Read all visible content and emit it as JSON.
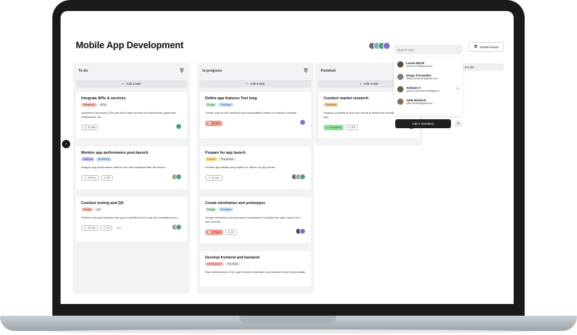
{
  "board": {
    "title": "Mobile App Development",
    "delete_label": "Delete board",
    "search_placeholder": "Search user",
    "add_list_label": "d a list",
    "members": [
      "#6b6b6b",
      "#8aa9c9",
      "#4f9a7a",
      "#7b6fd1"
    ]
  },
  "columns": [
    {
      "title": "To do",
      "add_task_label": "Add a task",
      "cards": [
        {
          "title": "Integrate APIs & services",
          "tags": [
            {
              "label": "Integration",
              "bg": "#f6c4bd",
              "fg": "#7a2b22"
            },
            {
              "label": "APIs",
              "bg": "#ececec",
              "fg": "#444"
            }
          ],
          "desc": "Implement necessary APIs and third-party services for features like payments, notifications, etc.",
          "date": "10 Jan.",
          "avatars": [
            "#4f9a7a"
          ]
        },
        {
          "title": "Monitor app performance post-launch",
          "tags": [
            {
              "label": "Analysis",
              "bg": "#cfc2f6",
              "fg": "#3e2d7a"
            },
            {
              "label": "Monitoring",
              "bg": "#cde0f8",
              "fg": "#23507e"
            }
          ],
          "desc": "Analyze app performance metrics and user feedback after the launch.",
          "date": "15 Feb.",
          "progress": "0/3",
          "avatars": [
            "#a89c8a",
            "#4f9a7a"
          ]
        },
        {
          "title": "Conduct testing and QA",
          "tags": [
            {
              "label": "Testing",
              "bg": "#f6c4bd",
              "fg": "#7a2b22"
            },
            {
              "label": "QA",
              "bg": "#ececec",
              "fg": "#444"
            }
          ],
          "desc": "Perform thorough testing of the app to identify and fix bugs and usability issues.",
          "date": "20 Jan.",
          "progress": "1/3",
          "comments": "1",
          "avatars": [
            "#a89c8a",
            "#4f9a7a"
          ]
        }
      ]
    },
    {
      "title": "In progress",
      "add_task_label": "Add a task",
      "cards": [
        {
          "title": "Define app features Test long",
          "tags": [
            {
              "label": "Design",
              "bg": "#cdefd2",
              "fg": "#24622e"
            },
            {
              "label": "Prototype",
              "bg": "#cde0f8",
              "fg": "#23507e"
            }
          ],
          "desc": "Create a list of core features and functionalities based on research findings.",
          "date": "15 Oct.",
          "date_red": true,
          "avatars": [
            "#7b6fd1"
          ]
        },
        {
          "title": "Prepare for app launch",
          "tags": [
            {
              "label": "Launch",
              "bg": "#f8e38a",
              "fg": "#6a5410"
            },
            {
              "label": "Preparation",
              "bg": "#ececec",
              "fg": "#444"
            }
          ],
          "desc": "Finalize app details and prepare for launch on app stores.",
          "date": "31 Jan.",
          "avatars": [
            "#6b6b6b",
            "#a89c8a",
            "#4f9a7a"
          ]
        },
        {
          "title": "Create wireframes and prototypes",
          "tags": [
            {
              "label": "Design",
              "bg": "#cdefd2",
              "fg": "#24622e"
            },
            {
              "label": "Prototype",
              "bg": "#cde0f8",
              "fg": "#23507e"
            }
          ],
          "desc": "Design wireframes and interactive prototypes to visualize the app's layout and user journey.",
          "date": "27 Nov.",
          "date_red": true,
          "progress": "2/3",
          "avatars": [
            "#4a4a4a",
            "#7b6fd1"
          ]
        },
        {
          "title": "Develop frontend and backend",
          "tags": [
            {
              "label": "Development",
              "bg": "#f6c4bd",
              "fg": "#7a2b22"
            },
            {
              "label": "Full Stack",
              "bg": "#ececec",
              "fg": "#444"
            }
          ],
          "desc": "Start development of the app's frontend interface and backend server functionality.",
          "avatars": []
        }
      ]
    },
    {
      "title": "Finished",
      "add_task_label": "Add a task",
      "cards": [
        {
          "title": "Conduct market research",
          "tags": [
            {
              "label": "Research",
              "bg": "#f8cf9a",
              "fg": "#6e4210"
            }
          ],
          "desc": "Analyze competitors and user needs to define the f functionality for the app.",
          "status": "Completed",
          "progress": "3/3",
          "avatars": [
            "#3a3a3a"
          ]
        }
      ]
    }
  ],
  "dropdown": {
    "users": [
      {
        "name": "Lucas Morel",
        "email": "lucas.morel@gmail.com",
        "color": "#5a4a3a",
        "selected": false
      },
      {
        "name": "Diego Fernandez",
        "email": "diego.fernandez@gmail.com",
        "color": "#7a7a7a",
        "selected": false
      },
      {
        "name": "Antoine A",
        "email": "antoine.amoresse1996@gma...",
        "color": "#6b5a4a",
        "selected": true
      },
      {
        "name": "Julie Richard",
        "email": "julie.richard@gmail.com",
        "color": "#8a6a5a",
        "selected": false
      }
    ],
    "add_members_label": "Add 1 members"
  },
  "icons": {
    "sidebar_toggle": "chevron-right-icon"
  }
}
